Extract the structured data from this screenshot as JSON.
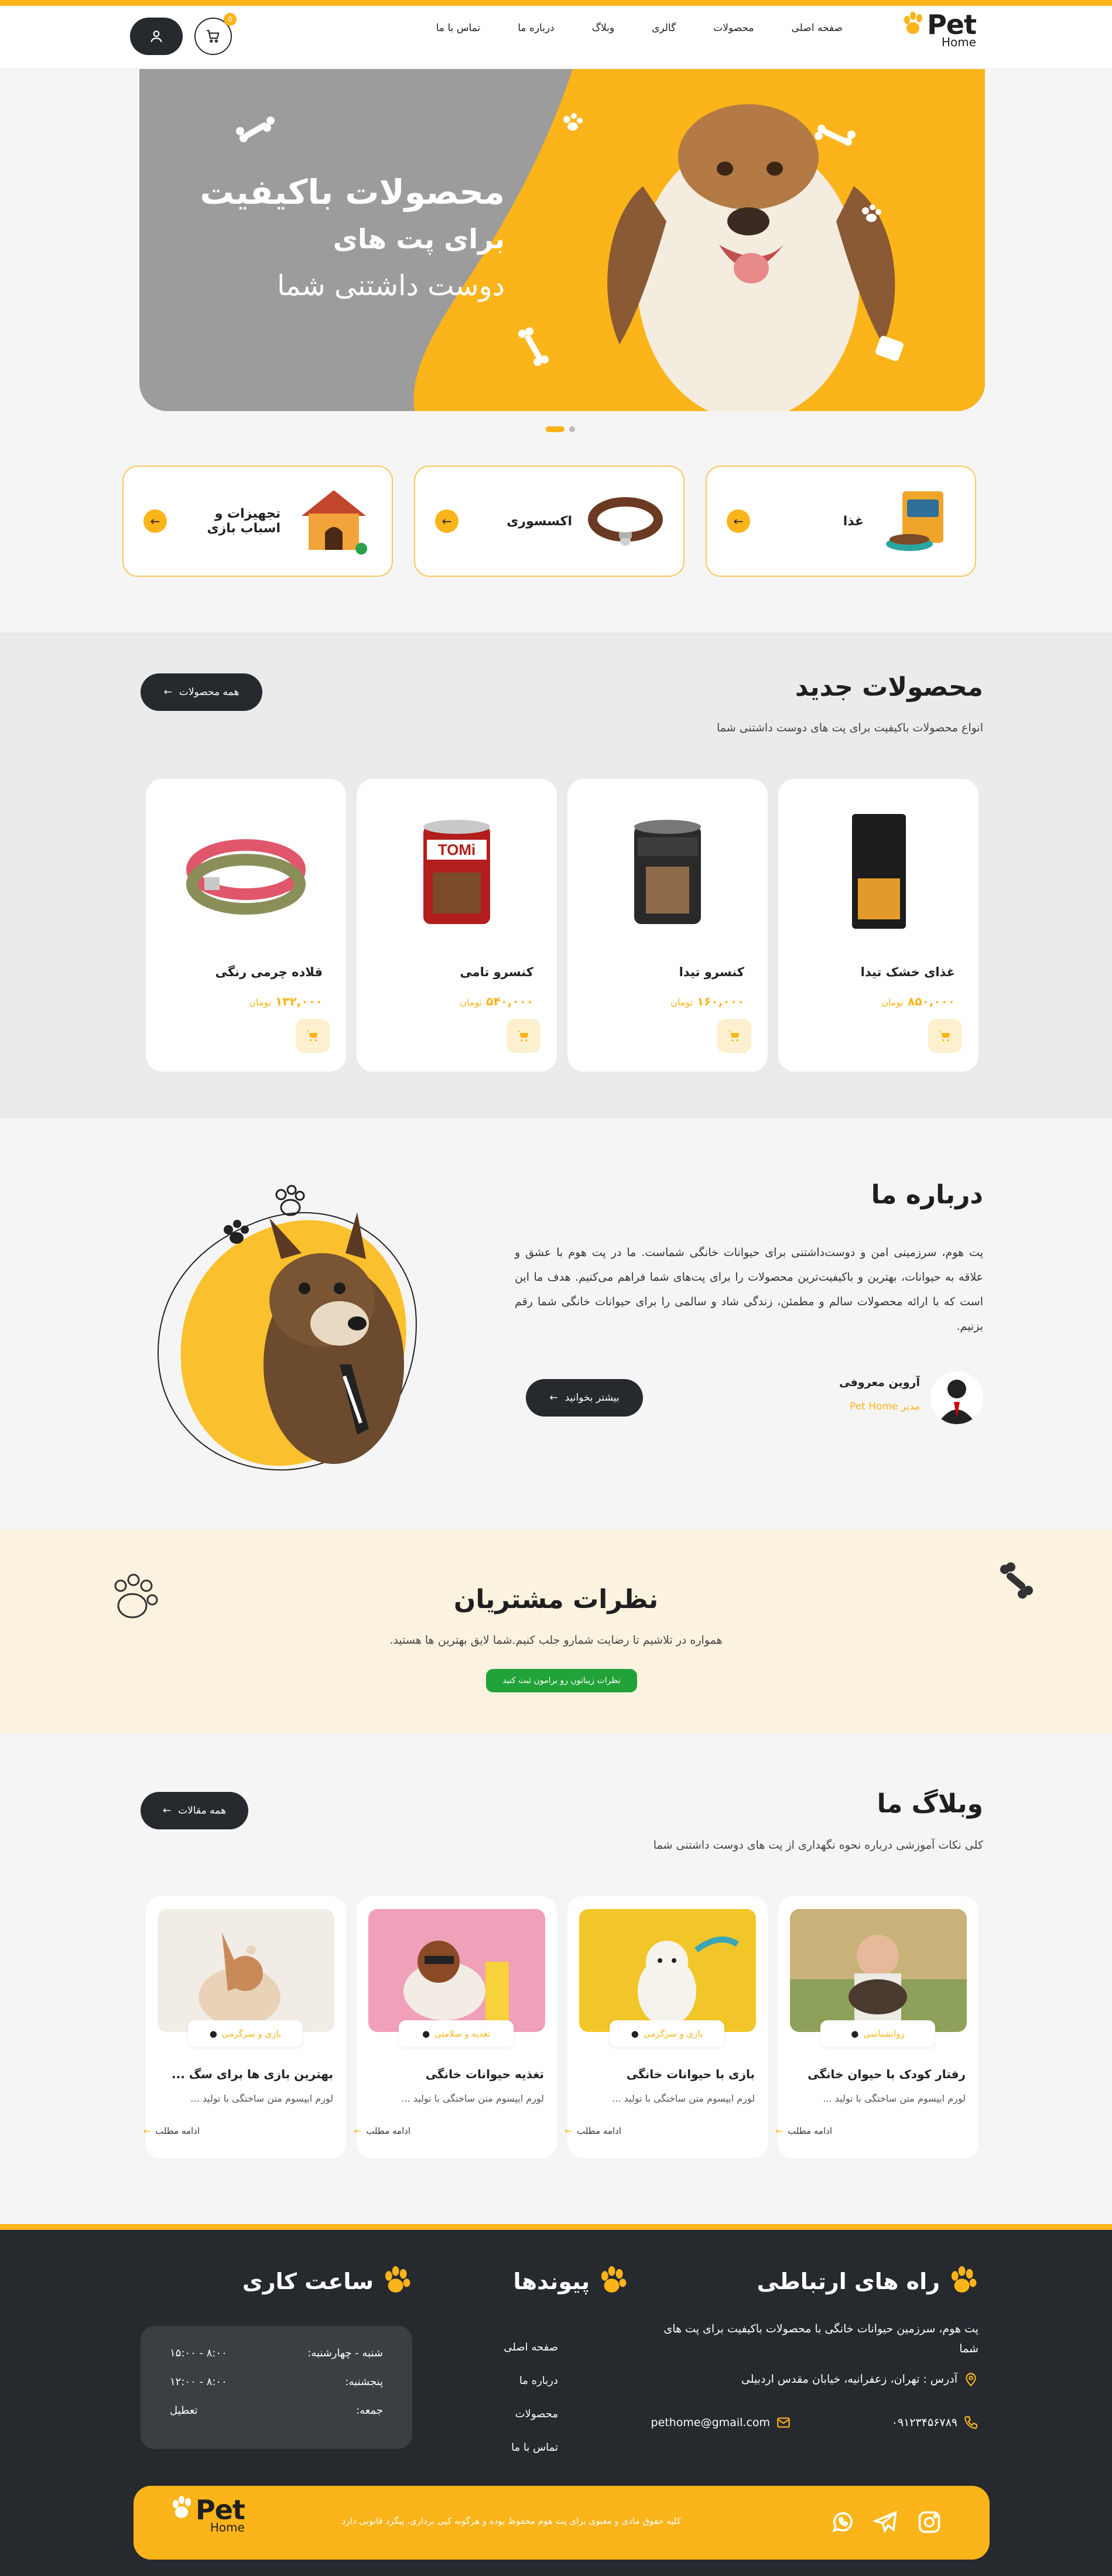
{
  "brand": {
    "name": "Pet",
    "sub": "Home"
  },
  "nav": {
    "items": [
      "صفحه اصلی",
      "محصولات",
      "گالری",
      "وبلاگ",
      "درباره ما",
      "تماس با ما"
    ]
  },
  "header": {
    "cart_count": "0"
  },
  "hero": {
    "line1": "محصولات باکیفیت",
    "line2": "برای پت های",
    "line3": "دوست داشتنی شما"
  },
  "categories": [
    {
      "label": "غذا",
      "icon": "pet-food-icon"
    },
    {
      "label": "اکسسوری",
      "icon": "collar-icon"
    },
    {
      "label": "تجهیزات و اسباب بازی",
      "icon": "dog-house-icon"
    }
  ],
  "products_section": {
    "title": "محصولات جدید",
    "subtitle": "انواع محصولات باکیفیت برای پت های دوست داشتنی شما",
    "all_button": "همه محصولات",
    "currency": "تومان",
    "items": [
      {
        "name": "غذای خشک تیدا",
        "price": "۸۵۰,۰۰۰"
      },
      {
        "name": "کنسرو تیدا",
        "price": "۱۶۰,۰۰۰"
      },
      {
        "name": "کنسرو تامی",
        "price": "۵۴۰,۰۰۰"
      },
      {
        "name": "قلاده چرمی رنگی",
        "price": "۱۳۲,۰۰۰"
      }
    ]
  },
  "about": {
    "title": "درباره ما",
    "text": "پت هوم، سرزمینی امن و دوست‌داشتنی برای حیوانات خانگی شماست. ما در پت هوم با عشق و علاقه به حیوانات، بهترین و باکیفیت‌ترین محصولات را برای پت‌های شما فراهم می‌کنیم. هدف ما این است که با ارائه محصولات سالم و مطمئن، زندگی شاد و سالمی را برای حیوانات خانگی شما رقم بزنیم.",
    "author": "آروین معروفی",
    "role_prefix": "مدیر",
    "role_brand": "Pet Home",
    "read_more": "بیشتر بخوانید"
  },
  "testimonials": {
    "title": "نظرات مشتریان",
    "subtitle": "همواره در تلاشیم تا رضایت شمارو جلب کنیم.شما لایق بهترین ها هستید.",
    "button": "نظرات زیباتون رو برامون ثبت کنید"
  },
  "blog": {
    "title": "وبلاگ ما",
    "subtitle": "کلی نکات آموزشی درباره نحوه نگهداری از پت های دوست داشتنی شما",
    "all_button": "همه مقالات",
    "read_more": "ادامه مطلب",
    "items": [
      {
        "tag": "روانشناسی",
        "title": "رفتار کودک با حیوان خانگی",
        "desc": "لورم ایپسوم متن ساختگی با تولید ..."
      },
      {
        "tag": "بازی و سرگرمی",
        "title": "بازی با حیوانات خانگی",
        "desc": "لورم ایپسوم متن ساختگی با تولید ..."
      },
      {
        "tag": "تغذیه و سلامتی",
        "title": "تغذیه حیوانات خانگی",
        "desc": "لورم ایپسوم متن ساختگی با تولید ..."
      },
      {
        "tag": "بازی و سرگرمی",
        "title": "بهترین بازی ها برای سگ ...",
        "desc": "لورم ایپسوم متن ساختگی با تولید ..."
      }
    ]
  },
  "footer": {
    "contact_title": "راه های ارتباطی",
    "contact_text": "پت هوم، سرزمین حیوانات خانگی با محصولات باکیفیت برای پت های شما",
    "address": "آدرس : تهران، زعفرانیه، خیابان مقدس اردبیلی",
    "phone": "۰۹۱۲۳۴۵۶۷۸۹",
    "email": "pethome@gmail.com",
    "links_title": "پیوندها",
    "links": [
      "صفحه اصلی",
      "درباره ما",
      "محصولات",
      "تماس با ما"
    ],
    "hours_title": "ساعت کاری",
    "hours": [
      {
        "day": "شنبه - چهارشنبه:",
        "time": "۸:۰۰ - ۱۵:۰۰"
      },
      {
        "day": "پنجشنبه:",
        "time": "۸:۰۰ - ۱۲:۰۰"
      },
      {
        "day": "جمعه:",
        "time": "تعطیل"
      }
    ],
    "copyright": "کلیه حقوق مادی و معنوی برای پت هوم محفوظ بوده و هرگونه کپی برداری، پیگرد قانونی دارد"
  },
  "colors": {
    "accent": "#fbb419",
    "dark": "#26292e",
    "green": "#22a33a"
  }
}
